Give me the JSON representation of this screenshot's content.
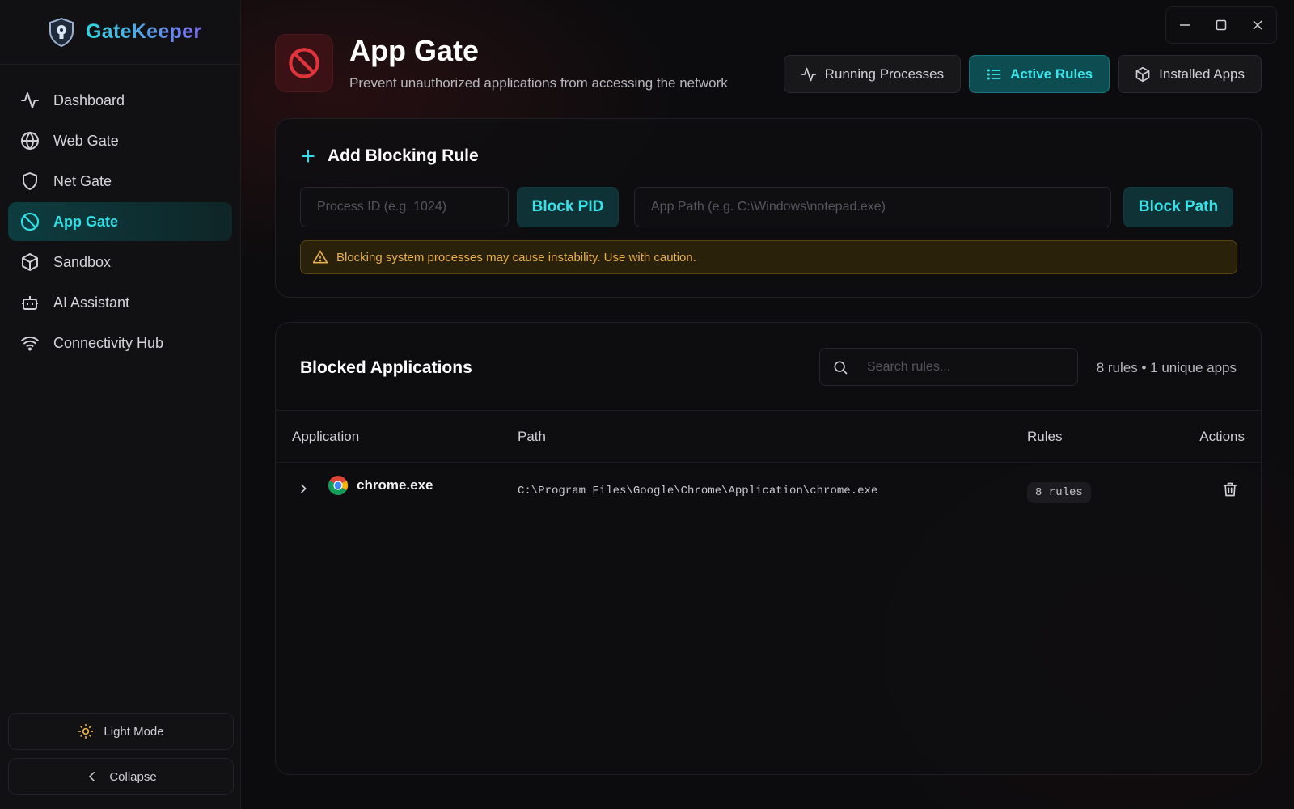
{
  "brand": {
    "name": "GateKeeper"
  },
  "sidebar": {
    "items": [
      {
        "label": "Dashboard",
        "icon": "activity-icon"
      },
      {
        "label": "Web Gate",
        "icon": "globe-icon"
      },
      {
        "label": "Net Gate",
        "icon": "shield-icon"
      },
      {
        "label": "App Gate",
        "icon": "ban-icon",
        "active": true
      },
      {
        "label": "Sandbox",
        "icon": "box-icon"
      },
      {
        "label": "AI Assistant",
        "icon": "robot-icon"
      },
      {
        "label": "Connectivity Hub",
        "icon": "wifi-icon"
      }
    ],
    "theme_toggle": "Light Mode",
    "collapse": "Collapse"
  },
  "header": {
    "title": "App Gate",
    "subtitle": "Prevent unauthorized applications from accessing the network"
  },
  "tabs": [
    {
      "label": "Running Processes",
      "active": false
    },
    {
      "label": "Active Rules",
      "active": true
    },
    {
      "label": "Installed Apps",
      "active": false
    }
  ],
  "add_rule": {
    "title": "Add Blocking Rule",
    "pid_placeholder": "Process ID (e.g. 1024)",
    "pid_value": "",
    "block_pid_label": "Block PID",
    "path_placeholder": "App Path (e.g. C:\\Windows\\notepad.exe)",
    "path_value": "",
    "block_path_label": "Block Path",
    "warning": "Blocking system processes may cause instability. Use with caution."
  },
  "blocked": {
    "title": "Blocked Applications",
    "search_placeholder": "Search rules...",
    "summary": "8 rules • 1 unique apps",
    "columns": {
      "application": "Application",
      "path": "Path",
      "rules": "Rules",
      "actions": "Actions"
    },
    "rows": [
      {
        "name": "chrome.exe",
        "path": "C:\\Program Files\\Google\\Chrome\\Application\\chrome.exe",
        "rules": "8 rules"
      }
    ]
  },
  "colors": {
    "accent": "#30e0e6",
    "danger": "#e0343c",
    "warning": "#e8b04a"
  }
}
